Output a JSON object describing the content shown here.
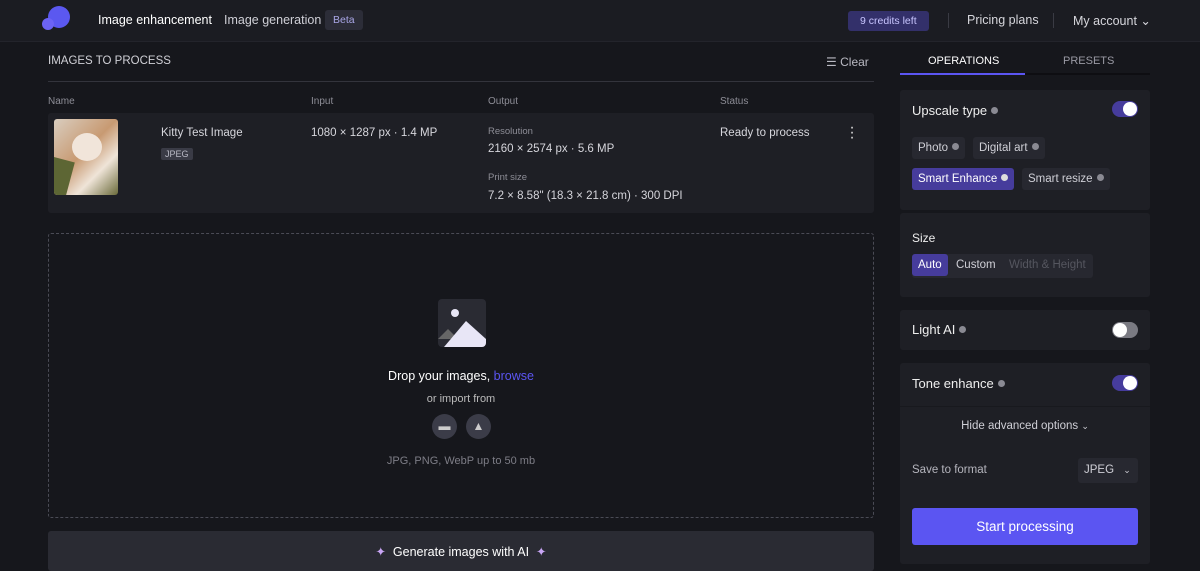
{
  "header": {
    "nav": [
      "Image enhancement",
      "Image generation"
    ],
    "beta": "Beta",
    "credits": "9 credits left",
    "pricing": "Pricing plans",
    "account": "My account"
  },
  "images": {
    "title": "IMAGES TO PROCESS",
    "clear": "Clear",
    "columns": [
      "Name",
      "Input",
      "Output",
      "Status"
    ],
    "rows": [
      {
        "name": "Kitty Test Image",
        "format": "JPEG",
        "input": "1080 × 1287 px · 1.4 MP",
        "resolution_label": "Resolution",
        "resolution": "2160 × 2574 px · 5.6 MP",
        "print_label": "Print size",
        "print": "7.2 × 8.58\" (18.3 × 21.8 cm) · 300 DPI",
        "status": "Ready to process"
      }
    ]
  },
  "drop": {
    "text": "Drop your images,",
    "browse": "browse",
    "import": "or import from",
    "formats": "JPG, PNG, WebP up to 50 mb"
  },
  "generate": "Generate images with AI",
  "panel": {
    "tabs": [
      "OPERATIONS",
      "PRESETS"
    ],
    "upscale_title": "Upscale type",
    "upscale_on": true,
    "types": [
      "Photo",
      "Digital art",
      "Smart Enhance",
      "Smart resize"
    ],
    "selected_type": "Smart Enhance",
    "size_title": "Size",
    "sizes": [
      "Auto",
      "Custom",
      "Width & Height"
    ],
    "light_ai": "Light AI",
    "light_ai_on": false,
    "tone": "Tone enhance",
    "tone_on": true,
    "advanced": "Hide advanced options",
    "save_label": "Save to format",
    "format": "JPEG",
    "start": "Start processing"
  },
  "colors": {
    "accent": "#5b55f2",
    "selected": "#463c9c"
  }
}
